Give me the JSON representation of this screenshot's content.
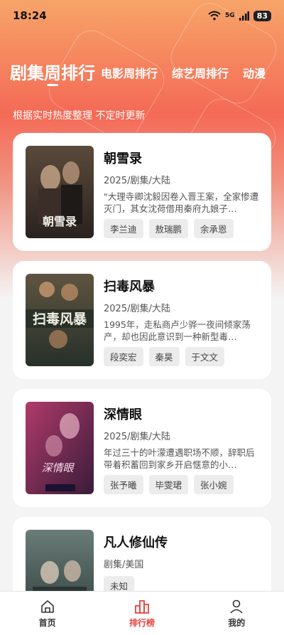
{
  "status_bar": {
    "time": "18:24",
    "network": "5G",
    "battery": "83"
  },
  "tabs": [
    {
      "label": "剧集周排行",
      "active": true
    },
    {
      "label": "电影周排行",
      "active": false
    },
    {
      "label": "综艺周排行",
      "active": false
    },
    {
      "label": "动漫",
      "active": false
    }
  ],
  "subtitle": "根据实时热度整理 不定时更新",
  "items": [
    {
      "title": "朝雪录",
      "meta": "2025/剧集/大陆",
      "description": "\"大理寺卿沈毅因卷入晋王案，全家惨遭灭门，其女沈荷借用秦府九娘子…",
      "cast": [
        "李兰迪",
        "敖瑞鹏",
        "余承恩"
      ],
      "poster_text": "朝雪录",
      "poster_colors": [
        "#5a4a3a",
        "#2a2220"
      ]
    },
    {
      "title": "扫毒风暴",
      "meta": "2025/剧集/大陆",
      "description": "1995年，走私商卢少骅一夜间倾家荡产，却也因此意识到一种新型毒…",
      "cast": [
        "段奕宏",
        "秦昊",
        "于文文"
      ],
      "poster_text": "扫毒风暴",
      "poster_colors": [
        "#5f5440",
        "#26302a"
      ]
    },
    {
      "title": "深情眼",
      "meta": "2025/剧集/大陆",
      "description": "年过三十的叶濛遭遇职场不顺，辞职后带着积蓄回到家乡开启惬意的小…",
      "cast": [
        "张予曦",
        "毕雯珺",
        "张小婉"
      ],
      "poster_text": "深情眼",
      "poster_colors": [
        "#b03a6a",
        "#3a1c3a"
      ]
    },
    {
      "title": "凡人修仙传",
      "meta": "剧集/美国",
      "description": "",
      "cast": [
        "未知"
      ],
      "poster_text": "",
      "poster_colors": [
        "#6a7c78",
        "#30403c"
      ]
    }
  ],
  "bottom_nav": [
    {
      "label": "首页",
      "icon": "home-icon",
      "active": false
    },
    {
      "label": "排行榜",
      "icon": "ranking-icon",
      "active": true
    },
    {
      "label": "我的",
      "icon": "profile-icon",
      "active": false
    }
  ],
  "colors": {
    "accent": "#e8413e",
    "hero_top": "#f7a468",
    "hero_mid": "#f46a56"
  }
}
